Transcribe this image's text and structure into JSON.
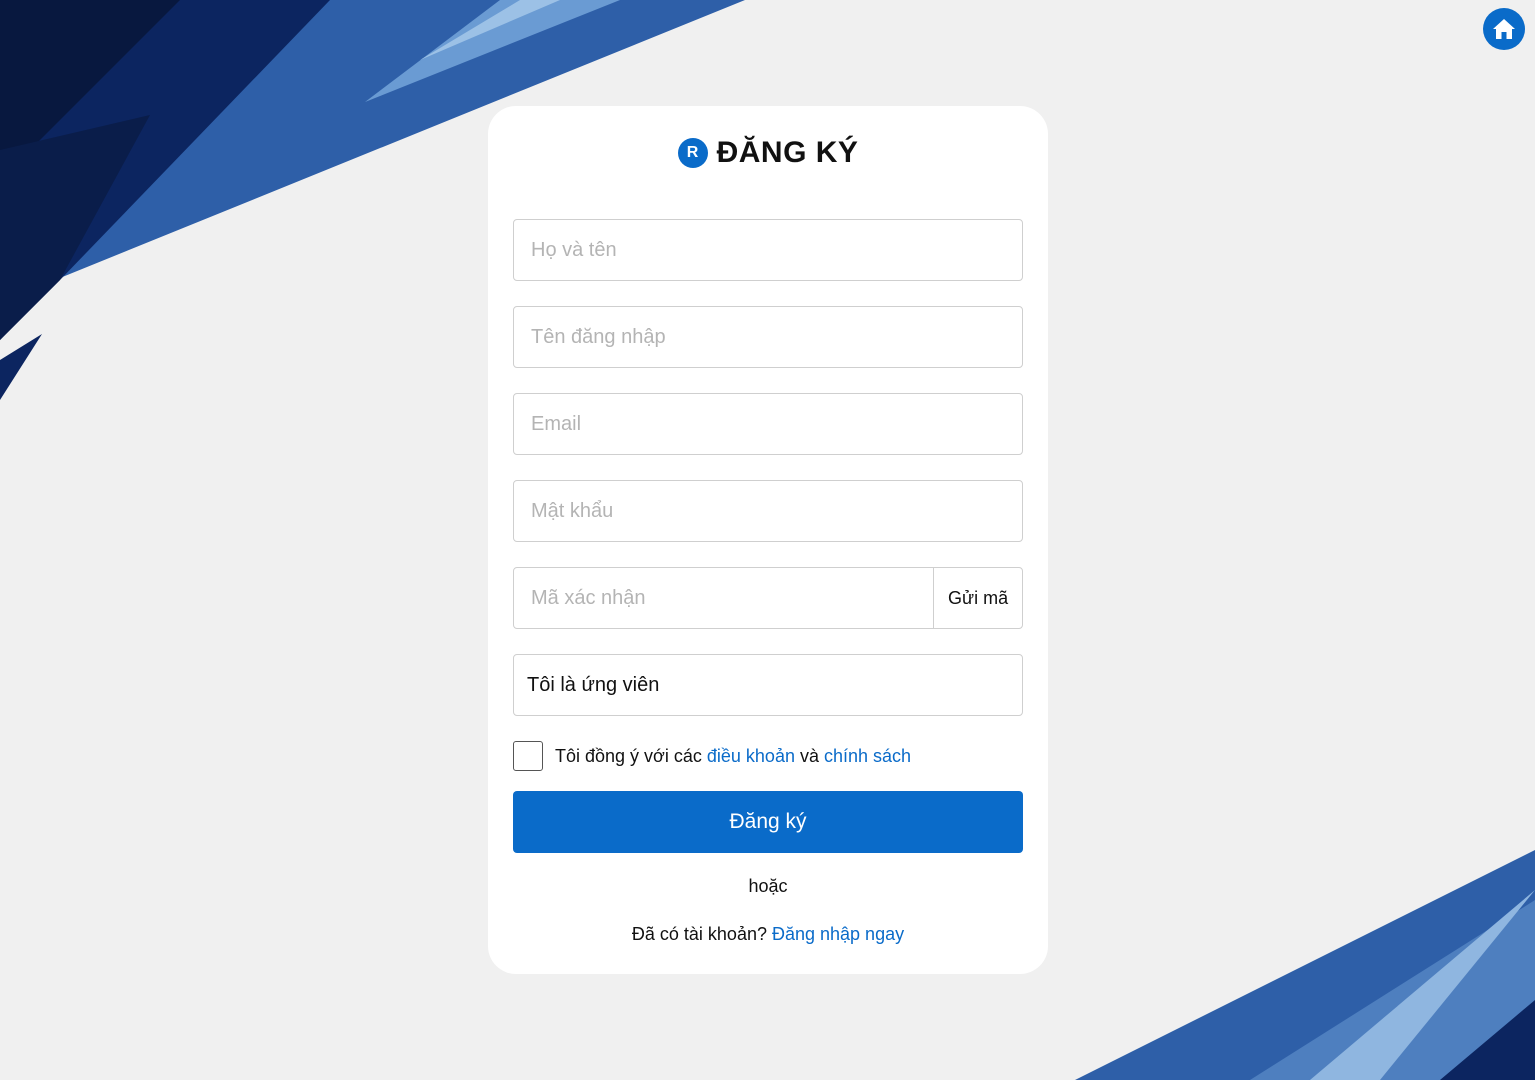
{
  "colors": {
    "accent": "#0a6bc9",
    "background": "#f0f0f0",
    "card": "#ffffff",
    "dark_navy": "#0b1f4d"
  },
  "home": {
    "icon": "home-icon"
  },
  "form": {
    "logo_letter": "R",
    "title": "ĐĂNG KÝ",
    "full_name_placeholder": "Họ và tên",
    "username_placeholder": "Tên đăng nhập",
    "email_placeholder": "Email",
    "password_placeholder": "Mật khẩu",
    "code_placeholder": "Mã xác nhận",
    "send_code_label": "Gửi mã",
    "role_value": "Tôi là ứng viên",
    "agree_prefix": "Tôi đồng ý với các",
    "terms_link": "điều khoản",
    "agree_and": "và",
    "policy_link": "chính sách",
    "submit_label": "Đăng ký",
    "or_text": "hoặc",
    "have_account": "Đã có tài khoản?",
    "login_link": "Đăng nhập ngay"
  }
}
